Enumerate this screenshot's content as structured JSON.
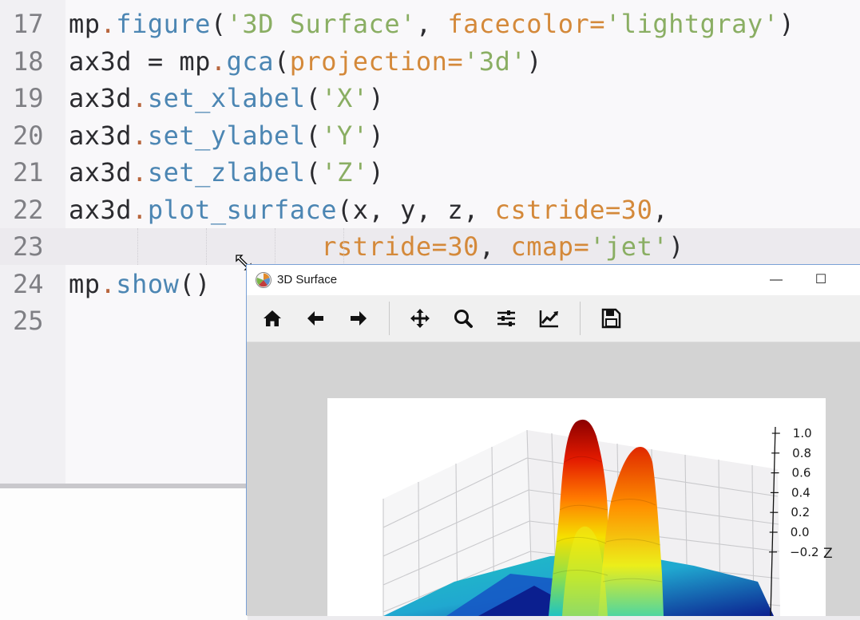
{
  "editor": {
    "lines": [
      {
        "num": "17",
        "tokens": [
          {
            "t": "mp",
            "c": "ident"
          },
          {
            "t": ".",
            "c": "dot"
          },
          {
            "t": "figure",
            "c": "func"
          },
          {
            "t": "(",
            "c": "punct"
          },
          {
            "t": "'3D Surface'",
            "c": "str"
          },
          {
            "t": ", ",
            "c": "punct"
          },
          {
            "t": "facecolor",
            "c": "kw"
          },
          {
            "t": "=",
            "c": "kw"
          },
          {
            "t": "'lightgray'",
            "c": "str"
          },
          {
            "t": ")",
            "c": "punct"
          }
        ]
      },
      {
        "num": "18",
        "tokens": [
          {
            "t": "ax3d ",
            "c": "ident"
          },
          {
            "t": "= ",
            "c": "op"
          },
          {
            "t": "mp",
            "c": "ident"
          },
          {
            "t": ".",
            "c": "dot"
          },
          {
            "t": "gca",
            "c": "func"
          },
          {
            "t": "(",
            "c": "punct"
          },
          {
            "t": "projection",
            "c": "kw"
          },
          {
            "t": "=",
            "c": "kw"
          },
          {
            "t": "'3d'",
            "c": "str"
          },
          {
            "t": ")",
            "c": "punct"
          }
        ]
      },
      {
        "num": "19",
        "tokens": [
          {
            "t": "ax3d",
            "c": "ident"
          },
          {
            "t": ".",
            "c": "dot"
          },
          {
            "t": "set_xlabel",
            "c": "func"
          },
          {
            "t": "(",
            "c": "punct"
          },
          {
            "t": "'X'",
            "c": "str"
          },
          {
            "t": ")",
            "c": "punct"
          }
        ]
      },
      {
        "num": "20",
        "tokens": [
          {
            "t": "ax3d",
            "c": "ident"
          },
          {
            "t": ".",
            "c": "dot"
          },
          {
            "t": "set_ylabel",
            "c": "func"
          },
          {
            "t": "(",
            "c": "punct"
          },
          {
            "t": "'Y'",
            "c": "str"
          },
          {
            "t": ")",
            "c": "punct"
          }
        ]
      },
      {
        "num": "21",
        "tokens": [
          {
            "t": "ax3d",
            "c": "ident"
          },
          {
            "t": ".",
            "c": "dot"
          },
          {
            "t": "set_zlabel",
            "c": "func"
          },
          {
            "t": "(",
            "c": "punct"
          },
          {
            "t": "'Z'",
            "c": "str"
          },
          {
            "t": ")",
            "c": "punct"
          }
        ]
      },
      {
        "num": "22",
        "tokens": [
          {
            "t": "ax3d",
            "c": "ident"
          },
          {
            "t": ".",
            "c": "dot"
          },
          {
            "t": "plot_surface",
            "c": "func"
          },
          {
            "t": "(",
            "c": "punct"
          },
          {
            "t": "x, y, z, ",
            "c": "ident"
          },
          {
            "t": "cstride",
            "c": "kw"
          },
          {
            "t": "=",
            "c": "kw"
          },
          {
            "t": "30",
            "c": "num"
          },
          {
            "t": ",",
            "c": "punct"
          }
        ]
      },
      {
        "num": "23",
        "active": true,
        "tokens": [
          {
            "t": "                ",
            "c": "ident"
          },
          {
            "t": "rstride",
            "c": "kw"
          },
          {
            "t": "=",
            "c": "kw"
          },
          {
            "t": "30",
            "c": "num"
          },
          {
            "t": ", ",
            "c": "punct"
          },
          {
            "t": "cmap",
            "c": "kw"
          },
          {
            "t": "=",
            "c": "kw"
          },
          {
            "t": "'jet'",
            "c": "str"
          },
          {
            "t": ")",
            "c": "punct"
          }
        ]
      },
      {
        "num": "24",
        "tokens": [
          {
            "t": "mp",
            "c": "ident"
          },
          {
            "t": ".",
            "c": "dot"
          },
          {
            "t": "show",
            "c": "func"
          },
          {
            "t": "()",
            "c": "punct"
          }
        ]
      },
      {
        "num": "25",
        "tokens": []
      }
    ]
  },
  "window": {
    "title": "3D Surface",
    "minimize_glyph": "—",
    "maximize_glyph": "☐",
    "toolbar": [
      {
        "icon": "home-icon",
        "name": "home-button"
      },
      {
        "icon": "arrow-left-icon",
        "name": "back-button"
      },
      {
        "icon": "arrow-right-icon",
        "name": "forward-button"
      },
      {
        "icon": "move-icon",
        "name": "pan-button"
      },
      {
        "icon": "zoom-icon",
        "name": "zoom-button"
      },
      {
        "icon": "sliders-icon",
        "name": "configure-subplots-button"
      },
      {
        "icon": "chart-line-icon",
        "name": "edit-axis-button"
      },
      {
        "icon": "save-icon",
        "name": "save-button"
      }
    ],
    "figure_facecolor": "#d3d3d3"
  },
  "chart_data": {
    "type": "surface",
    "cmap": "jet",
    "zlabel": "Z",
    "z_ticks": [
      "1.0",
      "0.8",
      "0.6",
      "0.4",
      "0.2",
      "0.0",
      "−0.2"
    ],
    "zlim": [
      -0.2,
      1.0
    ],
    "grid": true,
    "colors": {
      "low": "#0b1f8f",
      "mid": "#1fc3c2",
      "high": "#8b0000"
    }
  }
}
